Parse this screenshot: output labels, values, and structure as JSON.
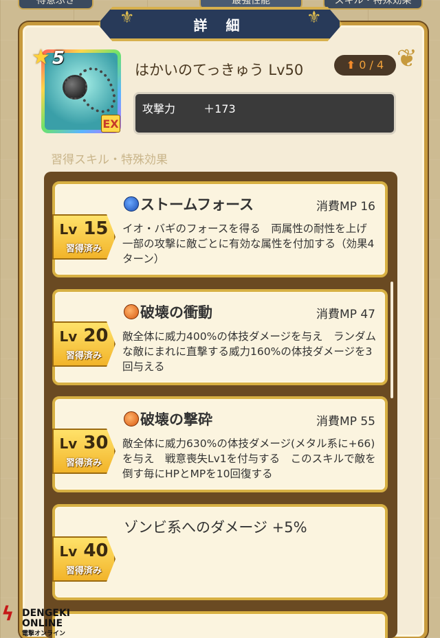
{
  "top_tabs": [
    "得意ぶき",
    "最強性能",
    "スキル・特殊効果"
  ],
  "header": {
    "title": "詳 細"
  },
  "item": {
    "rarity": "5",
    "badge": "EX",
    "name": "はかいのてっきゅう Lv50",
    "upgrade": "0 / 4",
    "stat_label": "攻撃力",
    "stat_value": "＋173"
  },
  "section_label": "習得スキル・特殊効果",
  "skills": [
    {
      "lv": "15",
      "lv_prefix": "Lv",
      "status": "習得済み",
      "icon": "blue-orb-icon",
      "name": "ストームフォース",
      "mp": "消費MP 16",
      "desc": "イオ・バギのフォースを得る　両属性の耐性を上げ　一部の攻撃に敵ごとに有効な属性を付加する（効果4ターン）"
    },
    {
      "lv": "20",
      "lv_prefix": "Lv",
      "status": "習得済み",
      "icon": "orange-orb-icon",
      "name": "破壊の衝動",
      "mp": "消費MP 47",
      "desc": "敵全体に威力400%の体技ダメージを与え　ランダムな敵にまれに直撃する威力160%の体技ダメージを3回与える"
    },
    {
      "lv": "30",
      "lv_prefix": "Lv",
      "status": "習得済み",
      "icon": "orange-orb-icon",
      "name": "破壊の撃砕",
      "mp": "消費MP 55",
      "desc": "敵全体に威力630%の体技ダメージ(メタル系に+66)を与え　戦意喪失Lv1を付与する　このスキルで敵を倒す毎にHPとMPを10回復する"
    },
    {
      "lv": "40",
      "lv_prefix": "Lv",
      "status": "習得済み",
      "name": "ゾンビ系へのダメージ +5%"
    }
  ],
  "watermark": {
    "line1": "DENGEKI",
    "line2": "ONLINE",
    "line3": "電撃オンライン"
  }
}
